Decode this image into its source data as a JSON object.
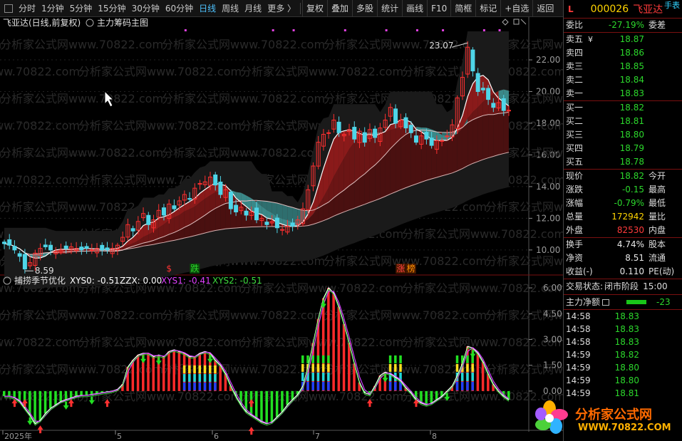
{
  "toolbar": {
    "periods": [
      "分时",
      "1分钟",
      "5分钟",
      "15分钟",
      "30分钟",
      "60分钟",
      "日线",
      "周线",
      "月线",
      "更多 〉"
    ],
    "active_period": "日线",
    "tools": [
      "复权",
      "叠加",
      "多股",
      "统计",
      "画线",
      "F10",
      "简框",
      "标记",
      "+自选",
      "返回"
    ]
  },
  "main_chart": {
    "stock_label": "飞亚达(日线,前复权)",
    "indicator_label": "主力筹码主图",
    "y_ticks": [
      "22.00",
      "20.00",
      "18.00",
      "16.00",
      "14.00",
      "12.00",
      "10.00"
    ],
    "y_range": [
      8.6,
      23.8
    ],
    "high_label": "23.07",
    "low_label": "8.59",
    "markers": [
      {
        "text": "$",
        "color": "#ff3333"
      },
      {
        "text": "跌",
        "color": "#2cd82c"
      },
      {
        "text": "涨",
        "color": "#ff4040"
      },
      {
        "text": "榜",
        "color": "#ff9000"
      }
    ],
    "watermark": "分析家公式网www.70822.com"
  },
  "sub_chart": {
    "name": "捕捞季节优化",
    "XYS0": "XYS0: -0.51",
    "ZZX": "ZZX: 0.00",
    "XYS1": "XYS1: -0.41",
    "XYS2": "XYS2: -0.51",
    "y_ticks": [
      "6.00",
      "4.50",
      "3.00",
      "1.50",
      "0.00"
    ],
    "y_range": [
      -2.2,
      6.5
    ]
  },
  "x_axis": {
    "labels": [
      "2025年",
      "5",
      "6",
      "7",
      "8"
    ]
  },
  "chart_data": [
    {
      "type": "candlestick",
      "title": "飞亚达(日线,前复权)",
      "close": [
        10.4,
        10.3,
        10.0,
        9.6,
        8.8,
        9.2,
        9.8,
        10.1,
        10.2,
        10.0,
        9.9,
        10.0,
        10.1,
        10.2,
        10.1,
        10.0,
        10.1,
        10.0,
        10.1,
        10.0,
        10.0,
        10.1,
        10.3,
        10.8,
        11.6,
        11.2,
        11.8,
        12.3,
        11.6,
        11.9,
        12.5,
        12.2,
        12.9,
        12.6,
        13.1,
        13.5,
        13.2,
        13.9,
        14.2,
        14.3,
        14.6,
        14.1,
        13.5,
        13.8,
        12.6,
        12.4,
        12.7,
        12.2,
        12.4,
        11.9,
        12.0,
        11.6,
        11.8,
        11.4,
        11.3,
        11.5,
        11.5,
        11.9,
        12.6,
        13.8,
        15.3,
        16.8,
        17.3,
        17.4,
        18.2,
        17.4,
        17.3,
        17.6,
        17.0,
        17.5,
        16.8,
        17.6,
        17.1,
        17.7,
        18.2,
        19.0,
        18.0,
        18.2,
        17.7,
        17.4,
        16.8,
        17.2,
        17.0,
        16.6,
        16.9,
        16.9,
        17.2,
        17.9,
        19.6,
        20.9,
        22.8,
        21.3,
        20.0,
        20.1,
        19.5,
        19.0,
        19.3,
        18.8,
        18.82
      ],
      "high": 23.07,
      "low": 8.59
    },
    {
      "type": "bar",
      "title": "捕捞季节优化",
      "values": [
        -0.3,
        -0.3,
        -0.4,
        -0.6,
        -1.0,
        -1.4,
        -1.9,
        -1.7,
        -1.3,
        -1.0,
        -0.8,
        -0.6,
        -0.5,
        -0.4,
        -0.3,
        -0.25,
        -0.25,
        -0.2,
        -0.15,
        -0.1,
        -0.05,
        0.0,
        0.1,
        0.4,
        1.4,
        1.8,
        2.1,
        2.2,
        2.2,
        2.0,
        2.1,
        2.0,
        2.3,
        2.4,
        2.3,
        2.2,
        2.0,
        2.0,
        2.2,
        2.3,
        2.2,
        1.8,
        1.5,
        1.0,
        0.3,
        -0.3,
        -0.8,
        -1.2,
        -1.4,
        -1.6,
        -1.8,
        -1.9,
        -1.8,
        -1.5,
        -1.2,
        -0.8,
        -0.5,
        -0.2,
        0.3,
        1.4,
        2.8,
        4.2,
        5.4,
        6.0,
        5.7,
        4.9,
        3.9,
        2.8,
        1.6,
        0.5,
        -0.1,
        -0.2,
        0.3,
        0.9,
        1.1,
        1.0,
        0.8,
        0.6,
        0.2,
        -0.1,
        -0.5,
        -0.7,
        -0.8,
        -0.7,
        -0.5,
        -0.3,
        0.0,
        0.3,
        0.9,
        1.6,
        2.6,
        2.5,
        2.2,
        1.7,
        1.0,
        0.4,
        0.0,
        -0.3,
        -0.51
      ],
      "ylim": [
        -2.2,
        6.5
      ]
    }
  ],
  "sidebar": {
    "header_letter": "L",
    "code": "000026",
    "name": "飞亚达",
    "top_tag": "手表",
    "weibi_label": "委比",
    "weibi_value": "-27.19%",
    "weicha_label": "委差",
    "sells": [
      {
        "label": "卖五",
        "tag": "¥",
        "price": "18.87"
      },
      {
        "label": "卖四",
        "tag": "",
        "price": "18.86"
      },
      {
        "label": "卖三",
        "tag": "",
        "price": "18.85"
      },
      {
        "label": "卖二",
        "tag": "",
        "price": "18.84"
      },
      {
        "label": "卖一",
        "tag": "",
        "price": "18.83"
      }
    ],
    "buys": [
      {
        "label": "买一",
        "price": "18.82"
      },
      {
        "label": "买二",
        "price": "18.81"
      },
      {
        "label": "买三",
        "price": "18.80"
      },
      {
        "label": "买四",
        "price": "18.79"
      },
      {
        "label": "买五",
        "price": "18.78"
      }
    ],
    "quote": [
      {
        "label": "现价",
        "value": "18.82",
        "label2": "今开",
        "color": "#2cd82c"
      },
      {
        "label": "涨跌",
        "value": "-0.15",
        "label2": "最高",
        "color": "#2cd82c"
      },
      {
        "label": "涨幅",
        "value": "-0.79%",
        "label2": "最低",
        "color": "#2cd82c"
      },
      {
        "label": "总量",
        "value": "172942",
        "label2": "量比",
        "color": "#ffd400"
      },
      {
        "label": "外盘",
        "value": "82530",
        "label2": "内盘",
        "color": "#ff3b3b"
      }
    ],
    "quote2": [
      {
        "label": "换手",
        "value": "4.74%",
        "label2": "股本"
      },
      {
        "label": "净资",
        "value": "8.51",
        "label2": "流通"
      },
      {
        "label": "收益(-)",
        "value": "0.110",
        "label2": "PE(动)"
      }
    ],
    "trade_status_label": "交易状态:",
    "trade_status": "闭市阶段",
    "trade_time": "15:00",
    "net_label": "主力净额",
    "net_value": "-23",
    "ticks": [
      {
        "time": "14:58",
        "price": "18.83",
        "color": "#2cd82c"
      },
      {
        "time": "14:58",
        "price": "18.83",
        "color": "#2cd82c"
      },
      {
        "time": "14:58",
        "price": "18.83",
        "color": "#2cd82c"
      },
      {
        "time": "14:59",
        "price": "18.82",
        "color": "#2cd82c"
      },
      {
        "time": "14:59",
        "price": "18.80",
        "color": "#2cd82c"
      },
      {
        "time": "14:59",
        "price": "18.80",
        "color": "#2cd82c"
      },
      {
        "time": "14:59",
        "price": "18.81",
        "color": "#2cd82c"
      }
    ],
    "logo_text": "分析家公式网",
    "logo_url": "WWW.70822.COM"
  }
}
